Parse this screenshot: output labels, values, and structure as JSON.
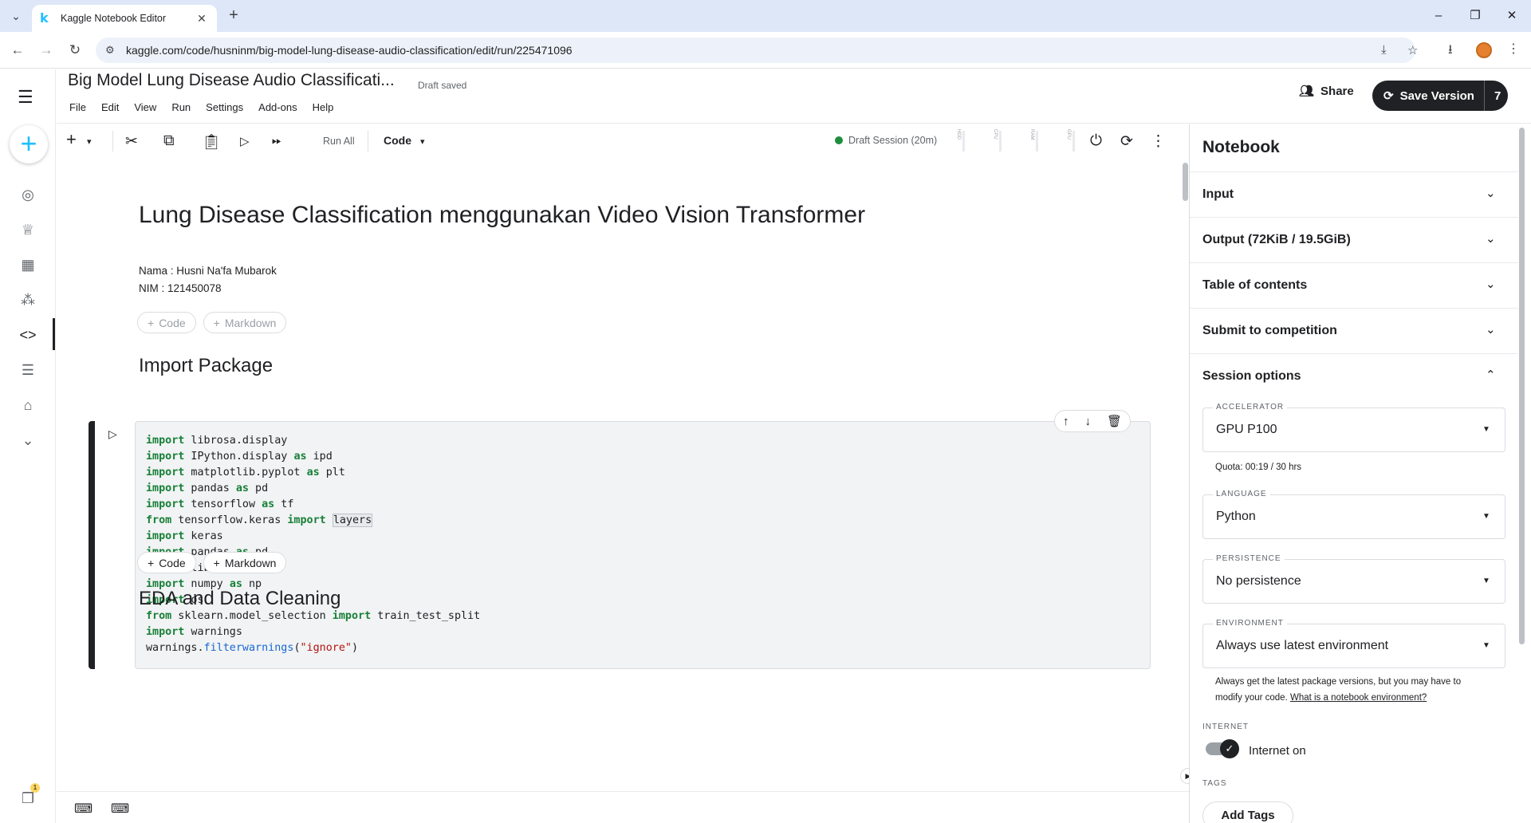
{
  "browser": {
    "tab_title": "Kaggle Notebook Editor",
    "tab_favicon": "k",
    "url": "kaggle.com/code/husninm/big-model-lung-disease-audio-classification/edit/run/225471096"
  },
  "header": {
    "title": "Big Model Lung Disease Audio Classificati...",
    "draft_status": "Draft saved",
    "menu": [
      "File",
      "Edit",
      "View",
      "Run",
      "Settings",
      "Add-ons",
      "Help"
    ],
    "share_label": "Share",
    "save_label": "Save Version",
    "version_count": "7"
  },
  "toolbar": {
    "run_all_label": "Run All",
    "cell_type": "Code",
    "session_status": "Draft Session (20m)",
    "meters": [
      "HDD",
      "CPU",
      "RAM",
      "GPU"
    ]
  },
  "notebook": {
    "title": "Lung Disease Classification menggunakan Video Vision Transformer",
    "author_line": "Nama : Husni Na'fa Mubarok",
    "nim_line": "NIM : 121450078",
    "add_code_label": "Code",
    "add_markdown_label": "Markdown",
    "section1": "Import Package",
    "section2": "EDA and Data Cleaning",
    "code_lines": [
      "import librosa.display",
      "import IPython.display as ipd",
      "import matplotlib.pyplot as plt",
      "import pandas as pd",
      "import tensorflow as tf",
      "from tensorflow.keras import layers",
      "import keras",
      "import pandas as pd",
      "import librosa",
      "import numpy as np",
      "import os",
      "from sklearn.model_selection import train_test_split",
      "import warnings",
      "warnings.filterwarnings(\"ignore\")"
    ]
  },
  "panel": {
    "title": "Notebook",
    "sections": [
      "Input",
      "Output (72KiB / 19.5GiB)",
      "Table of contents",
      "Submit to competition",
      "Session options"
    ],
    "accelerator_label": "ACCELERATOR",
    "accelerator_value": "GPU P100",
    "quota": "Quota: 00:19 / 30 hrs",
    "language_label": "LANGUAGE",
    "language_value": "Python",
    "persistence_label": "PERSISTENCE",
    "persistence_value": "No persistence",
    "environment_label": "ENVIRONMENT",
    "environment_value": "Always use latest environment",
    "env_note_1": "Always get the latest package versions, but you may have to",
    "env_note_2": "modify your code.",
    "env_note_link": "What is a notebook environment?",
    "internet_label": "INTERNET",
    "internet_value": "Internet on",
    "internet_on": true,
    "tags_label": "TAGS",
    "add_tags_label": "Add Tags"
  },
  "leftnav": {
    "notification_count": "1"
  },
  "colors": {
    "accent": "#20beff",
    "dark": "#202124",
    "session_green": "#1e8e3e"
  }
}
